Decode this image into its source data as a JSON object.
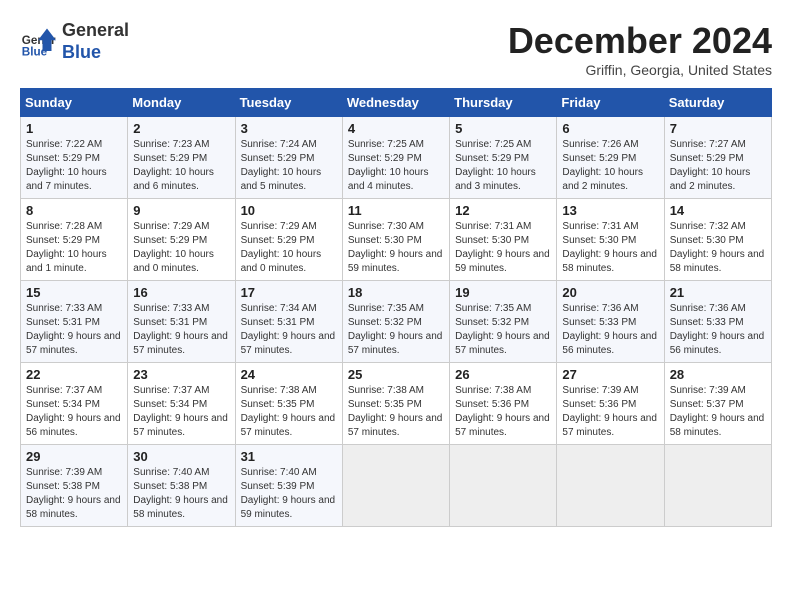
{
  "logo": {
    "general": "General",
    "blue": "Blue"
  },
  "header": {
    "title": "December 2024",
    "subtitle": "Griffin, Georgia, United States"
  },
  "days_of_week": [
    "Sunday",
    "Monday",
    "Tuesday",
    "Wednesday",
    "Thursday",
    "Friday",
    "Saturday"
  ],
  "weeks": [
    [
      {
        "day": 1,
        "sunrise": "7:22 AM",
        "sunset": "5:29 PM",
        "daylight": "10 hours and 7 minutes."
      },
      {
        "day": 2,
        "sunrise": "7:23 AM",
        "sunset": "5:29 PM",
        "daylight": "10 hours and 6 minutes."
      },
      {
        "day": 3,
        "sunrise": "7:24 AM",
        "sunset": "5:29 PM",
        "daylight": "10 hours and 5 minutes."
      },
      {
        "day": 4,
        "sunrise": "7:25 AM",
        "sunset": "5:29 PM",
        "daylight": "10 hours and 4 minutes."
      },
      {
        "day": 5,
        "sunrise": "7:25 AM",
        "sunset": "5:29 PM",
        "daylight": "10 hours and 3 minutes."
      },
      {
        "day": 6,
        "sunrise": "7:26 AM",
        "sunset": "5:29 PM",
        "daylight": "10 hours and 2 minutes."
      },
      {
        "day": 7,
        "sunrise": "7:27 AM",
        "sunset": "5:29 PM",
        "daylight": "10 hours and 2 minutes."
      }
    ],
    [
      {
        "day": 8,
        "sunrise": "7:28 AM",
        "sunset": "5:29 PM",
        "daylight": "10 hours and 1 minute."
      },
      {
        "day": 9,
        "sunrise": "7:29 AM",
        "sunset": "5:29 PM",
        "daylight": "10 hours and 0 minutes."
      },
      {
        "day": 10,
        "sunrise": "7:29 AM",
        "sunset": "5:29 PM",
        "daylight": "10 hours and 0 minutes."
      },
      {
        "day": 11,
        "sunrise": "7:30 AM",
        "sunset": "5:30 PM",
        "daylight": "9 hours and 59 minutes."
      },
      {
        "day": 12,
        "sunrise": "7:31 AM",
        "sunset": "5:30 PM",
        "daylight": "9 hours and 59 minutes."
      },
      {
        "day": 13,
        "sunrise": "7:31 AM",
        "sunset": "5:30 PM",
        "daylight": "9 hours and 58 minutes."
      },
      {
        "day": 14,
        "sunrise": "7:32 AM",
        "sunset": "5:30 PM",
        "daylight": "9 hours and 58 minutes."
      }
    ],
    [
      {
        "day": 15,
        "sunrise": "7:33 AM",
        "sunset": "5:31 PM",
        "daylight": "9 hours and 57 minutes."
      },
      {
        "day": 16,
        "sunrise": "7:33 AM",
        "sunset": "5:31 PM",
        "daylight": "9 hours and 57 minutes."
      },
      {
        "day": 17,
        "sunrise": "7:34 AM",
        "sunset": "5:31 PM",
        "daylight": "9 hours and 57 minutes."
      },
      {
        "day": 18,
        "sunrise": "7:35 AM",
        "sunset": "5:32 PM",
        "daylight": "9 hours and 57 minutes."
      },
      {
        "day": 19,
        "sunrise": "7:35 AM",
        "sunset": "5:32 PM",
        "daylight": "9 hours and 57 minutes."
      },
      {
        "day": 20,
        "sunrise": "7:36 AM",
        "sunset": "5:33 PM",
        "daylight": "9 hours and 56 minutes."
      },
      {
        "day": 21,
        "sunrise": "7:36 AM",
        "sunset": "5:33 PM",
        "daylight": "9 hours and 56 minutes."
      }
    ],
    [
      {
        "day": 22,
        "sunrise": "7:37 AM",
        "sunset": "5:34 PM",
        "daylight": "9 hours and 56 minutes."
      },
      {
        "day": 23,
        "sunrise": "7:37 AM",
        "sunset": "5:34 PM",
        "daylight": "9 hours and 57 minutes."
      },
      {
        "day": 24,
        "sunrise": "7:38 AM",
        "sunset": "5:35 PM",
        "daylight": "9 hours and 57 minutes."
      },
      {
        "day": 25,
        "sunrise": "7:38 AM",
        "sunset": "5:35 PM",
        "daylight": "9 hours and 57 minutes."
      },
      {
        "day": 26,
        "sunrise": "7:38 AM",
        "sunset": "5:36 PM",
        "daylight": "9 hours and 57 minutes."
      },
      {
        "day": 27,
        "sunrise": "7:39 AM",
        "sunset": "5:36 PM",
        "daylight": "9 hours and 57 minutes."
      },
      {
        "day": 28,
        "sunrise": "7:39 AM",
        "sunset": "5:37 PM",
        "daylight": "9 hours and 58 minutes."
      }
    ],
    [
      {
        "day": 29,
        "sunrise": "7:39 AM",
        "sunset": "5:38 PM",
        "daylight": "9 hours and 58 minutes."
      },
      {
        "day": 30,
        "sunrise": "7:40 AM",
        "sunset": "5:38 PM",
        "daylight": "9 hours and 58 minutes."
      },
      {
        "day": 31,
        "sunrise": "7:40 AM",
        "sunset": "5:39 PM",
        "daylight": "9 hours and 59 minutes."
      },
      null,
      null,
      null,
      null
    ]
  ]
}
